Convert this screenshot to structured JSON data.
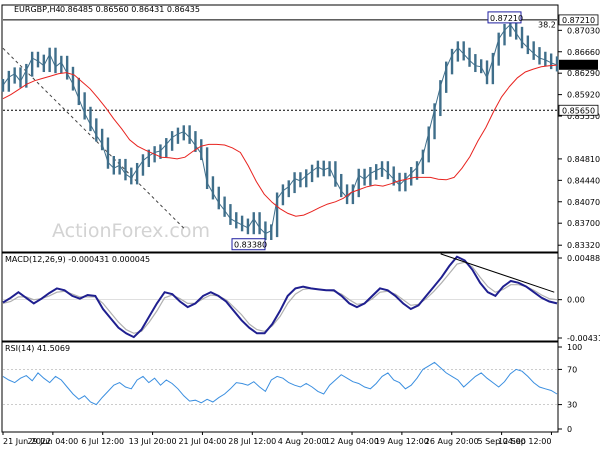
{
  "header": {
    "symbol": "EURGBP,H4",
    "ohlc": "0.86485 0.86560 0.86431 0.86435"
  },
  "watermark": "ActionForex.com",
  "colors": {
    "price": "#3f6e8a",
    "ma": "#e8231f",
    "macd": "#1f1f8f",
    "signal": "#b0b0b0",
    "rsi": "#3b8fe0",
    "frame": "#000000",
    "grid": "#000000"
  },
  "chart_data": [
    {
      "type": "line",
      "panel": "price",
      "y_ticks": [
        "0.87030",
        "0.86660",
        "0.86290",
        "0.85920",
        "0.85550",
        "0.84810",
        "0.84440",
        "0.84070",
        "0.83700",
        "0.83320"
      ],
      "ylim": [
        0.8322,
        0.8745
      ],
      "x_labels": [
        "21 Jun 2022",
        "29 Jun 04:00",
        "6 Jul 12:00",
        "13 Jul 20:00",
        "21 Jul 04:00",
        "28 Jul 12:00",
        "4 Aug 20:00",
        "12 Aug 04:00",
        "19 Aug 12:00",
        "26 Aug 20:00",
        "5 Sep 04:00",
        "12 Sep 12:00"
      ],
      "price_series": [
        0.8608,
        0.8622,
        0.8628,
        0.8615,
        0.8634,
        0.8655,
        0.865,
        0.8642,
        0.8662,
        0.864,
        0.8648,
        0.8629,
        0.861,
        0.8585,
        0.856,
        0.854,
        0.8522,
        0.8507,
        0.8475,
        0.8465,
        0.847,
        0.8455,
        0.8448,
        0.8463,
        0.8478,
        0.8486,
        0.8492,
        0.8495,
        0.8506,
        0.8518,
        0.8524,
        0.8528,
        0.8518,
        0.8504,
        0.849,
        0.844,
        0.8422,
        0.8405,
        0.8392,
        0.8378,
        0.8372,
        0.8367,
        0.8362,
        0.8378,
        0.8362,
        0.8352,
        0.8357,
        0.8412,
        0.8426,
        0.8433,
        0.8447,
        0.8443,
        0.8452,
        0.846,
        0.8467,
        0.8462,
        0.8466,
        0.8444,
        0.8426,
        0.8414,
        0.8426,
        0.8453,
        0.8446,
        0.8456,
        0.8461,
        0.8466,
        0.8457,
        0.8446,
        0.8436,
        0.8446,
        0.8456,
        0.8466,
        0.8486,
        0.8526,
        0.8566,
        0.8606,
        0.8638,
        0.866,
        0.8673,
        0.8662,
        0.8651,
        0.8642,
        0.864,
        0.8621,
        0.8653,
        0.8688,
        0.8703,
        0.8713,
        0.8698,
        0.8683,
        0.8673,
        0.8663,
        0.8655,
        0.8652,
        0.8647,
        0.8643
      ],
      "ma_series": [
        0.8585,
        0.8592,
        0.8601,
        0.861,
        0.8616,
        0.862,
        0.8624,
        0.8628,
        0.863,
        0.8626,
        0.8614,
        0.8602,
        0.8586,
        0.8569,
        0.855,
        0.8533,
        0.8514,
        0.8503,
        0.8496,
        0.849,
        0.8484,
        0.8483,
        0.8481,
        0.8484,
        0.8494,
        0.8503,
        0.8506,
        0.8506,
        0.8505,
        0.85,
        0.8492,
        0.8469,
        0.8442,
        0.842,
        0.8406,
        0.8395,
        0.8387,
        0.8382,
        0.8384,
        0.839,
        0.8397,
        0.8403,
        0.8407,
        0.8413,
        0.8423,
        0.8428,
        0.8433,
        0.8436,
        0.8434,
        0.8438,
        0.8443,
        0.8446,
        0.8449,
        0.8449,
        0.8449,
        0.8446,
        0.8445,
        0.8449,
        0.8465,
        0.8485,
        0.8512,
        0.8535,
        0.8563,
        0.8588,
        0.8606,
        0.8621,
        0.8631,
        0.8636,
        0.864,
        0.8642,
        0.8643
      ],
      "hlines": [
        {
          "label": "0.87210",
          "value": 0.8721
        },
        {
          "label": "0.85650",
          "value": 0.8565
        }
      ],
      "annotations": [
        {
          "text": "0.87210",
          "value": 0.8721
        },
        {
          "text": "0.83380",
          "value": 0.8338
        },
        {
          "text": "38.2",
          "value": 0.8708
        }
      ],
      "trendline": [
        [
          0.0,
          0.8672
        ],
        [
          0.33,
          0.8358
        ]
      ],
      "current_price_label": "0.86435",
      "current_price": 0.86435
    },
    {
      "type": "line",
      "panel": "macd",
      "title": "MACD(12,26,9) -0.000431 0.000045",
      "y_ticks": [
        "0.004885",
        "0.00",
        "-0.004315"
      ],
      "ylim": [
        -0.004315,
        0.004885
      ],
      "macd_series": [
        -0.0003,
        0.0002,
        0.0008,
        0.0002,
        -0.0004,
        0.0001,
        0.0007,
        0.0012,
        0.001,
        0.0004,
        0.0001,
        0.0005,
        0.0004,
        -0.001,
        -0.002,
        -0.003,
        -0.0036,
        -0.004,
        -0.0032,
        -0.0018,
        -0.0004,
        0.0008,
        0.0006,
        -0.0002,
        -0.0008,
        -0.0004,
        0.0004,
        0.0008,
        0.0004,
        -0.0002,
        -0.0012,
        -0.0022,
        -0.003,
        -0.0036,
        -0.0036,
        -0.0026,
        -0.0012,
        0.0004,
        0.0012,
        0.0014,
        0.0012,
        0.0011,
        0.001,
        0.001,
        0.0004,
        -0.0004,
        -0.0008,
        -0.0004,
        0.0004,
        0.0012,
        0.001,
        0.0004,
        -0.0004,
        -0.001,
        -0.0006,
        0.0004,
        0.0014,
        0.0024,
        0.0036,
        0.0046,
        0.0042,
        0.0032,
        0.0018,
        0.0008,
        0.0004,
        0.0014,
        0.002,
        0.0018,
        0.0014,
        0.0008,
        0.0002,
        -0.0002,
        -0.0004
      ],
      "signal_series": [
        -0.0004,
        -0.0002,
        0.0003,
        0.0003,
        0.0,
        0.0001,
        0.0004,
        0.0008,
        0.0009,
        0.0006,
        0.0003,
        0.0003,
        0.0003,
        -0.0004,
        -0.0014,
        -0.0024,
        -0.0032,
        -0.0036,
        -0.0034,
        -0.0024,
        -0.0012,
        0.0002,
        0.0005,
        0.0001,
        -0.0004,
        -0.0004,
        0.0001,
        0.0005,
        0.0004,
        0.0,
        -0.0008,
        -0.0016,
        -0.0026,
        -0.0032,
        -0.0034,
        -0.0028,
        -0.0018,
        -0.0004,
        0.0006,
        0.0011,
        0.0012,
        0.0011,
        0.001,
        0.0009,
        0.0006,
        0.0,
        -0.0005,
        -0.0004,
        0.0001,
        0.0008,
        0.0009,
        0.0006,
        0.0,
        -0.0006,
        -0.0005,
        0.0001,
        0.0009,
        0.0018,
        0.0028,
        0.0038,
        0.004,
        0.0035,
        0.0024,
        0.0014,
        0.0008,
        0.0011,
        0.0016,
        0.0016,
        0.0014,
        0.001,
        0.0005,
        0.0001,
        0.0
      ],
      "trendline": [
        [
          0.79,
          0.0049
        ],
        [
          0.995,
          0.0008
        ]
      ]
    },
    {
      "type": "line",
      "panel": "rsi",
      "title": "RSI(14) 41.5069",
      "y_ticks": [
        "100",
        "70",
        "30",
        "0"
      ],
      "ylim": [
        0,
        100
      ],
      "levels": [
        70,
        30
      ],
      "rsi_series": [
        62,
        58,
        55,
        60,
        63,
        57,
        66,
        60,
        55,
        62,
        58,
        50,
        42,
        36,
        40,
        33,
        30,
        38,
        45,
        52,
        55,
        50,
        48,
        58,
        62,
        55,
        60,
        52,
        58,
        54,
        48,
        40,
        34,
        35,
        32,
        36,
        33,
        38,
        42,
        48,
        55,
        54,
        52,
        56,
        50,
        45,
        58,
        62,
        60,
        55,
        52,
        50,
        54,
        50,
        45,
        42,
        52,
        58,
        64,
        60,
        56,
        54,
        50,
        48,
        54,
        62,
        66,
        58,
        55,
        48,
        52,
        60,
        70,
        74,
        78,
        72,
        66,
        62,
        58,
        50,
        56,
        62,
        66,
        60,
        55,
        50,
        56,
        65,
        70,
        68,
        62,
        55,
        50,
        48,
        46,
        42
      ]
    }
  ]
}
